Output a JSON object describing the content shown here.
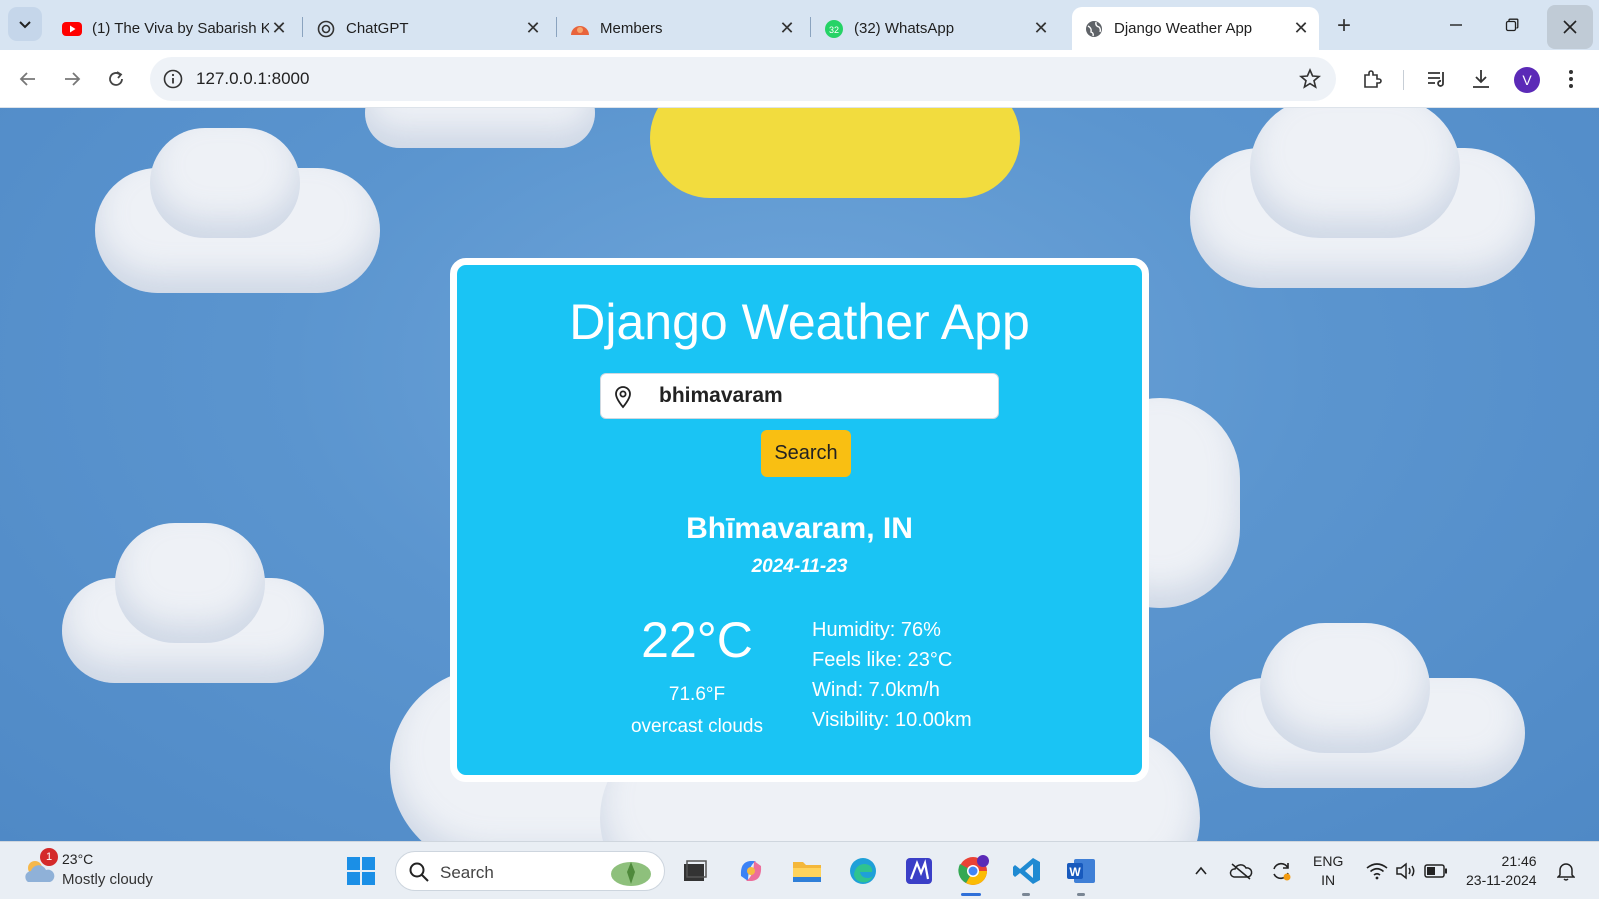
{
  "browser": {
    "tabs": [
      {
        "title": "(1) The Viva by Sabarish K",
        "favicon": "youtube-icon"
      },
      {
        "title": "ChatGPT",
        "favicon": "chatgpt-icon"
      },
      {
        "title": "Members",
        "favicon": "members-icon"
      },
      {
        "title": "(32) WhatsApp",
        "favicon": "whatsapp-icon",
        "badge": "32"
      },
      {
        "title": "Django Weather App",
        "favicon": "globe-icon",
        "active": true
      }
    ],
    "address": "127.0.0.1:8000",
    "profile_initial": "V"
  },
  "app": {
    "heading": "Django Weather App",
    "search_value": "bhimavaram",
    "search_button": "Search",
    "city": "Bhīmavaram, IN",
    "date": "2024-11-23",
    "temp_c": "22°C",
    "temp_f": "71.6°F",
    "description": "overcast clouds",
    "humidity": "Humidity: 76%",
    "feels_like": "Feels like: 23°C",
    "wind": "Wind: 7.0km/h",
    "visibility": "Visibility: 10.00km"
  },
  "taskbar": {
    "weather_temp": "23°C",
    "weather_desc": "Mostly cloudy",
    "weather_badge": "1",
    "search_label": "Search",
    "lang_line1": "ENG",
    "lang_line2": "IN",
    "time": "21:46",
    "date": "23-11-2024"
  },
  "colors": {
    "card": "#1ac4f4",
    "search_button": "#f9bf12",
    "sky": "#5b95cf"
  }
}
